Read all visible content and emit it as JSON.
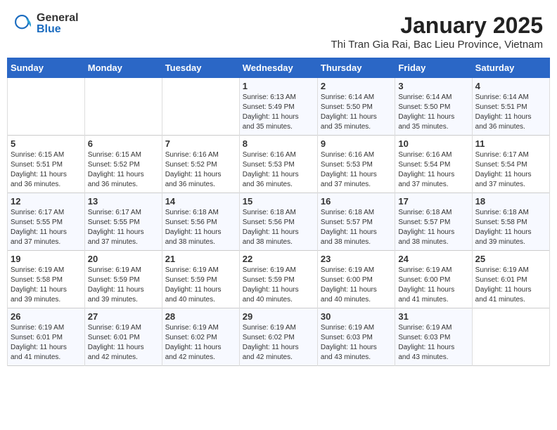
{
  "logo": {
    "general": "General",
    "blue": "Blue"
  },
  "title": "January 2025",
  "subtitle": "Thi Tran Gia Rai, Bac Lieu Province, Vietnam",
  "weekdays": [
    "Sunday",
    "Monday",
    "Tuesday",
    "Wednesday",
    "Thursday",
    "Friday",
    "Saturday"
  ],
  "weeks": [
    [
      {
        "day": "",
        "info": ""
      },
      {
        "day": "",
        "info": ""
      },
      {
        "day": "",
        "info": ""
      },
      {
        "day": "1",
        "info": "Sunrise: 6:13 AM\nSunset: 5:49 PM\nDaylight: 11 hours\nand 35 minutes."
      },
      {
        "day": "2",
        "info": "Sunrise: 6:14 AM\nSunset: 5:50 PM\nDaylight: 11 hours\nand 35 minutes."
      },
      {
        "day": "3",
        "info": "Sunrise: 6:14 AM\nSunset: 5:50 PM\nDaylight: 11 hours\nand 35 minutes."
      },
      {
        "day": "4",
        "info": "Sunrise: 6:14 AM\nSunset: 5:51 PM\nDaylight: 11 hours\nand 36 minutes."
      }
    ],
    [
      {
        "day": "5",
        "info": "Sunrise: 6:15 AM\nSunset: 5:51 PM\nDaylight: 11 hours\nand 36 minutes."
      },
      {
        "day": "6",
        "info": "Sunrise: 6:15 AM\nSunset: 5:52 PM\nDaylight: 11 hours\nand 36 minutes."
      },
      {
        "day": "7",
        "info": "Sunrise: 6:16 AM\nSunset: 5:52 PM\nDaylight: 11 hours\nand 36 minutes."
      },
      {
        "day": "8",
        "info": "Sunrise: 6:16 AM\nSunset: 5:53 PM\nDaylight: 11 hours\nand 36 minutes."
      },
      {
        "day": "9",
        "info": "Sunrise: 6:16 AM\nSunset: 5:53 PM\nDaylight: 11 hours\nand 37 minutes."
      },
      {
        "day": "10",
        "info": "Sunrise: 6:16 AM\nSunset: 5:54 PM\nDaylight: 11 hours\nand 37 minutes."
      },
      {
        "day": "11",
        "info": "Sunrise: 6:17 AM\nSunset: 5:54 PM\nDaylight: 11 hours\nand 37 minutes."
      }
    ],
    [
      {
        "day": "12",
        "info": "Sunrise: 6:17 AM\nSunset: 5:55 PM\nDaylight: 11 hours\nand 37 minutes."
      },
      {
        "day": "13",
        "info": "Sunrise: 6:17 AM\nSunset: 5:55 PM\nDaylight: 11 hours\nand 37 minutes."
      },
      {
        "day": "14",
        "info": "Sunrise: 6:18 AM\nSunset: 5:56 PM\nDaylight: 11 hours\nand 38 minutes."
      },
      {
        "day": "15",
        "info": "Sunrise: 6:18 AM\nSunset: 5:56 PM\nDaylight: 11 hours\nand 38 minutes."
      },
      {
        "day": "16",
        "info": "Sunrise: 6:18 AM\nSunset: 5:57 PM\nDaylight: 11 hours\nand 38 minutes."
      },
      {
        "day": "17",
        "info": "Sunrise: 6:18 AM\nSunset: 5:57 PM\nDaylight: 11 hours\nand 38 minutes."
      },
      {
        "day": "18",
        "info": "Sunrise: 6:18 AM\nSunset: 5:58 PM\nDaylight: 11 hours\nand 39 minutes."
      }
    ],
    [
      {
        "day": "19",
        "info": "Sunrise: 6:19 AM\nSunset: 5:58 PM\nDaylight: 11 hours\nand 39 minutes."
      },
      {
        "day": "20",
        "info": "Sunrise: 6:19 AM\nSunset: 5:59 PM\nDaylight: 11 hours\nand 39 minutes."
      },
      {
        "day": "21",
        "info": "Sunrise: 6:19 AM\nSunset: 5:59 PM\nDaylight: 11 hours\nand 40 minutes."
      },
      {
        "day": "22",
        "info": "Sunrise: 6:19 AM\nSunset: 5:59 PM\nDaylight: 11 hours\nand 40 minutes."
      },
      {
        "day": "23",
        "info": "Sunrise: 6:19 AM\nSunset: 6:00 PM\nDaylight: 11 hours\nand 40 minutes."
      },
      {
        "day": "24",
        "info": "Sunrise: 6:19 AM\nSunset: 6:00 PM\nDaylight: 11 hours\nand 41 minutes."
      },
      {
        "day": "25",
        "info": "Sunrise: 6:19 AM\nSunset: 6:01 PM\nDaylight: 11 hours\nand 41 minutes."
      }
    ],
    [
      {
        "day": "26",
        "info": "Sunrise: 6:19 AM\nSunset: 6:01 PM\nDaylight: 11 hours\nand 41 minutes."
      },
      {
        "day": "27",
        "info": "Sunrise: 6:19 AM\nSunset: 6:01 PM\nDaylight: 11 hours\nand 42 minutes."
      },
      {
        "day": "28",
        "info": "Sunrise: 6:19 AM\nSunset: 6:02 PM\nDaylight: 11 hours\nand 42 minutes."
      },
      {
        "day": "29",
        "info": "Sunrise: 6:19 AM\nSunset: 6:02 PM\nDaylight: 11 hours\nand 42 minutes."
      },
      {
        "day": "30",
        "info": "Sunrise: 6:19 AM\nSunset: 6:03 PM\nDaylight: 11 hours\nand 43 minutes."
      },
      {
        "day": "31",
        "info": "Sunrise: 6:19 AM\nSunset: 6:03 PM\nDaylight: 11 hours\nand 43 minutes."
      },
      {
        "day": "",
        "info": ""
      }
    ]
  ]
}
